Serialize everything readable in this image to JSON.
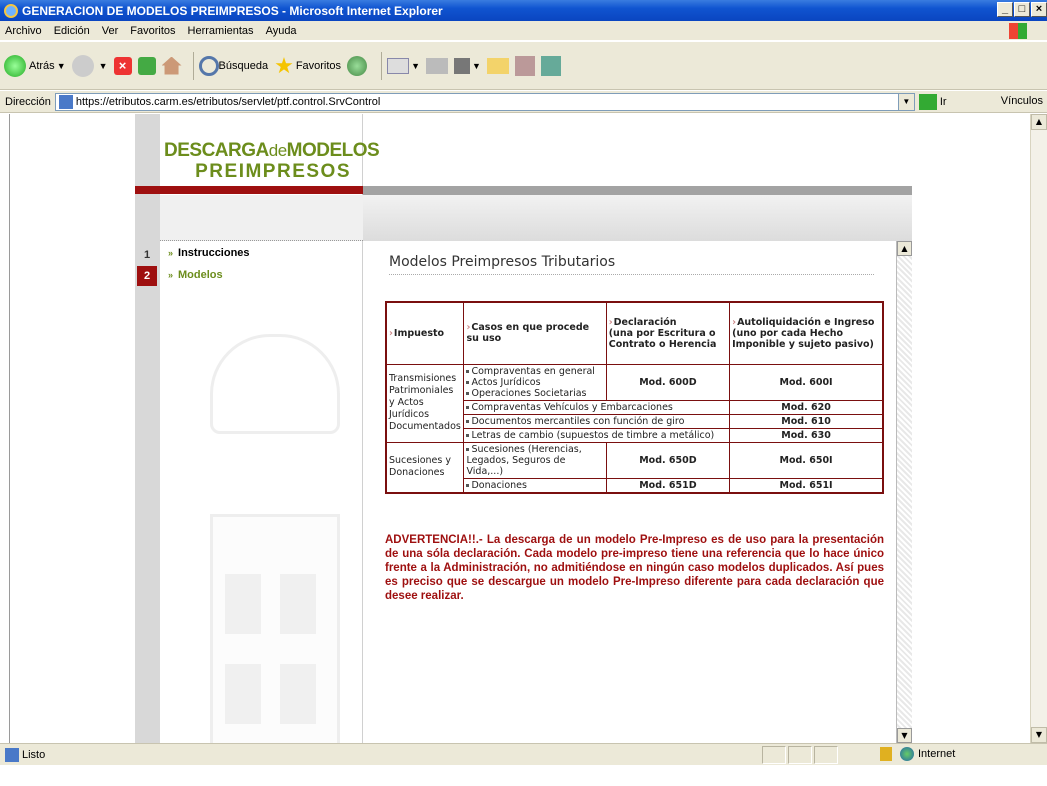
{
  "window": {
    "title": "GENERACION DE MODELOS PREIMPRESOS - Microsoft Internet Explorer",
    "controls": [
      "_",
      "□",
      "×"
    ]
  },
  "menu": [
    "Archivo",
    "Edición",
    "Ver",
    "Favoritos",
    "Herramientas",
    "Ayuda"
  ],
  "toolbar": {
    "back_label": "Atrás",
    "search_label": "Búsqueda",
    "favorites_label": "Favoritos"
  },
  "address": {
    "label": "Dirección",
    "url": "https://etributos.carm.es/etributos/servlet/ptf.control.SrvControl",
    "go_label": "Ir",
    "links_label": "Vínculos"
  },
  "site": {
    "logo_line1_a": "DESCARGA",
    "logo_line1_b": "de",
    "logo_line1_c": "MODELOS",
    "logo_line2": "PREIMPRESOS",
    "brand_color": "#6c8d1c",
    "accent_color": "#9e0f0f"
  },
  "nav": [
    {
      "num": "1",
      "label": "Instrucciones"
    },
    {
      "num": "2",
      "label": "Modelos"
    }
  ],
  "main": {
    "title": "Modelos Preimpresos Tributarios",
    "headers": {
      "impuesto": "Impuesto",
      "casos": "Casos en que procede su uso",
      "declaracion_1": "Declaración",
      "declaracion_2": "(una por Escritura o Contrato o Herencia",
      "autoliq_1": "Autoliquidación e Ingreso",
      "autoliq_2": "(uno por cada Hecho Imponible y sujeto pasivo)"
    },
    "group1": {
      "impuesto": "Transmisiones Patrimoniales y Actos Jurídicos Documentados",
      "row1_cases": [
        "Compraventas en general",
        "Actos Jurídicos",
        "Operaciones Societarias"
      ],
      "row1_decl": "Mod. 600D",
      "row1_auto": "Mod. 600I",
      "row2_case": "Compraventas Vehículos y Embarcaciones",
      "row2_auto": "Mod. 620",
      "row3_case": "Documentos mercantiles con función de giro",
      "row3_auto": "Mod. 610",
      "row4_case": "Letras de cambio (supuestos de timbre a metálico)",
      "row4_auto": "Mod. 630"
    },
    "group2": {
      "impuesto": "Sucesiones y Donaciones",
      "row1_case": "Sucesiones (Herencias, Legados, Seguros de Vida,...)",
      "row1_decl": "Mod. 650D",
      "row1_auto": "Mod. 650I",
      "row2_case": "Donaciones",
      "row2_decl": "Mod. 651D",
      "row2_auto": "Mod. 651I"
    },
    "warning": "ADVERTENCIA!!.- La descarga de un modelo Pre-Impreso es de uso para la presentación de una sóla declaración. Cada modelo pre-impreso tiene una referencia que lo hace único frente a la Administración, no admitiéndose en ningún caso modelos duplicados. Así pues es preciso que se descargue un modelo Pre-Impreso diferente para cada declaración que desee realizar."
  },
  "status": {
    "text": "Listo",
    "zone": "Internet"
  }
}
